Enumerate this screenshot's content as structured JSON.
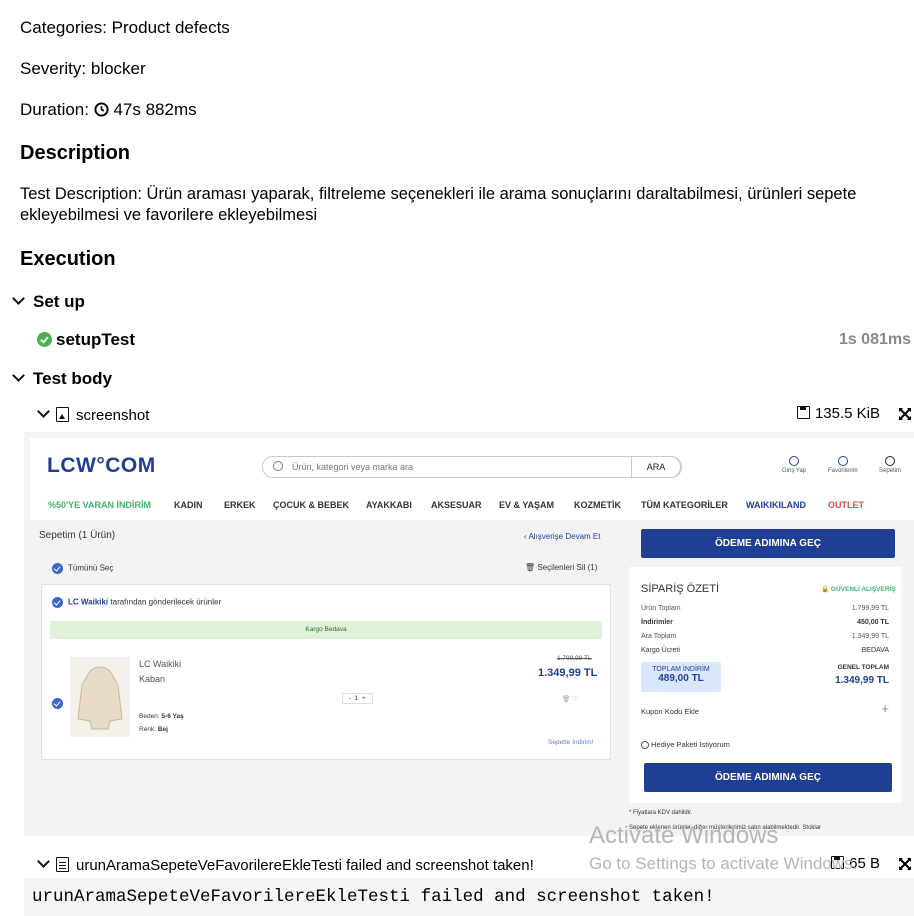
{
  "meta": {
    "categories_label": "Categories:",
    "categories_value": "Product defects",
    "severity_label": "Severity:",
    "severity_value": "blocker",
    "duration_label": "Duration:",
    "duration_value": "47s 882ms"
  },
  "description": {
    "heading": "Description",
    "text": "Test Description: Ürün araması yaparak, filtreleme seçenekleri ile arama sonuçlarını daraltabilmesi, ürünleri sepete ekleyebilmesi ve favorilere ekleyebilmesi"
  },
  "execution": {
    "heading": "Execution",
    "setup": {
      "label": "Set up",
      "step_name": "setupTest",
      "step_time": "1s 081ms"
    },
    "body": {
      "label": "Test body",
      "attachments": [
        {
          "name": "screenshot",
          "size": "135.5 KiB"
        },
        {
          "name": "urunAramaSepeteVeFavorilereEkleTesti failed and screenshot taken!",
          "size": "65 B"
        }
      ],
      "message": "urunAramaSepeteVeFavorilereEkleTesti failed and screenshot taken!"
    }
  },
  "screenshot": {
    "logo": "LCW°COM",
    "search_placeholder": "Ürün, kategori veya marka ara",
    "search_button": "ARA",
    "header_icons": [
      "Giriş Yap",
      "Favorilerim",
      "Sepetim"
    ],
    "nav": [
      "%50'YE VARAN İNDİRİM",
      "KADIN",
      "ERKEK",
      "ÇOCUK & BEBEK",
      "AYAKKABI",
      "AKSESUAR",
      "EV & YAŞAM",
      "KOZMETİK",
      "TÜM KATEGORİLER",
      "WAIKIKILAND",
      "OUTLET"
    ],
    "cart_title": "Sepetim (1 Ürün)",
    "continue_shopping": "Alışverişe Devam Et",
    "select_all": "Tümünü Seç",
    "delete_selected": "Seçilenleri Sil (1)",
    "seller_brand": "LC Waikiki",
    "seller_text": "tarafından gönderilecek ürünler",
    "shipping_free": "Kargo Bedava",
    "product_brand": "LC Waikiki",
    "product_name": "Kaban",
    "size_label": "Beden:",
    "size_value": "5-6 Yaş",
    "color_label": "Renk:",
    "color_value": "Bej",
    "quantity": "1",
    "old_price": "1.799,99 TL",
    "new_price": "1.349,99 TL",
    "cart_discount_note": "Sepette İndirim!",
    "checkout_button": "ÖDEME ADIMINA GEÇ",
    "summary_title": "SİPARİŞ ÖZETİ",
    "secure": "GÜVENLİ ALIŞVERİŞ",
    "summary_rows": [
      {
        "label": "Ürün Toplam",
        "value": "1.799,99 TL"
      },
      {
        "label": "İndirimler",
        "value": "450,00 TL"
      },
      {
        "label": "Ara Toplam",
        "value": "1.349,99 TL"
      },
      {
        "label": "Kargo Ücreti",
        "value": "BEDAVA"
      }
    ],
    "total_discount_label": "TOPLAM İNDİRİM",
    "total_discount_value": "489,00 TL",
    "grand_total_label": "GENEL TOPLAM",
    "grand_total_value": "1.349,99 TL",
    "coupon": "Kupon Kodu Ekle",
    "gift": "Hediye Paketi İstiyorum",
    "vat_note": "* Fiyatlara KDV dahildir.",
    "footer_note": "Sepete eklenen ürünler, diğer müşterilerimiz satın alabilmektedir. Stoklar"
  },
  "watermark": {
    "line1": "Activate Windows",
    "line2": "Go to Settings to activate Windows."
  },
  "colors": {
    "brand_blue": "#1f3f94",
    "green": "#3cb371",
    "pass_green": "#4caf50"
  }
}
